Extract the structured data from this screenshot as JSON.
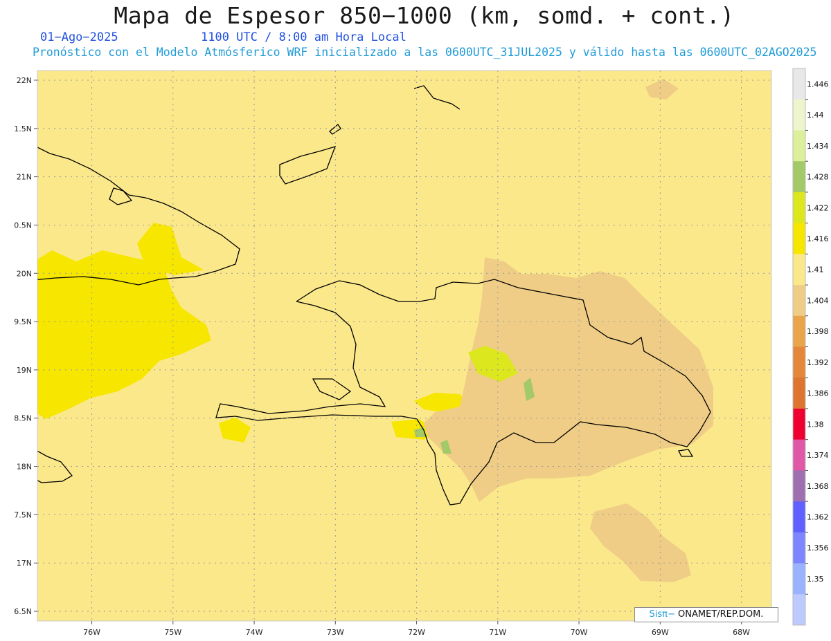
{
  "title": "Mapa de Espesor 850−1000 (km, somd. + cont.)",
  "date_text": "01−Ago−2025",
  "time_text": "1100 UTC / 8:00 am Hora Local",
  "forecast_text": "Pronóstico con el Modelo Atmósferico WRF inicializado a las 0600UTC_31JUL2025 y válido hasta las  0600UTC_02AGO2025",
  "credit": {
    "brand": "Sisπ−",
    "org": " ONAMET/REP.DOM."
  },
  "map": {
    "lat_range": [
      16.4,
      22.1
    ],
    "lon_range": [
      -76.67,
      -67.63
    ],
    "lat_labels": [
      "22N",
      "1.5N",
      "21N",
      "0.5N",
      "20N",
      "9.5N",
      "19N",
      "8.5N",
      "18N",
      "7.5N",
      "17N",
      "6.5N"
    ],
    "lat_values": [
      22,
      21.5,
      21,
      20.5,
      20,
      19.5,
      19,
      18.5,
      18,
      17.5,
      17,
      16.5
    ],
    "lon_labels": [
      "76W",
      "75W",
      "74W",
      "73W",
      "72W",
      "71W",
      "70W",
      "69W",
      "68W"
    ],
    "lon_values": [
      -76,
      -75,
      -74,
      -73,
      -72,
      -71,
      -70,
      -69,
      -68
    ],
    "background_color": "#fbe88b",
    "coastline_color": "#000000",
    "grid": "dotted"
  },
  "colorbar": {
    "levels": [
      "1.446",
      "1.44",
      "1.434",
      "1.428",
      "1.422",
      "1.416",
      "1.41",
      "1.404",
      "1.398",
      "1.392",
      "1.386",
      "1.38",
      "1.374",
      "1.368",
      "1.362",
      "1.356",
      "1.35"
    ],
    "colors": [
      "#e8e8e8",
      "#eef5cc",
      "#dcef9a",
      "#a4c968",
      "#dde71d",
      "#f6e600",
      "#fbe88b",
      "#efcd86",
      "#eaa449",
      "#e4873a",
      "#dd7430",
      "#ee0031",
      "#e058a6",
      "#9e70b0",
      "#5f60ff",
      "#7c86ff",
      "#9ab2ff",
      "#bccaff"
    ]
  }
}
